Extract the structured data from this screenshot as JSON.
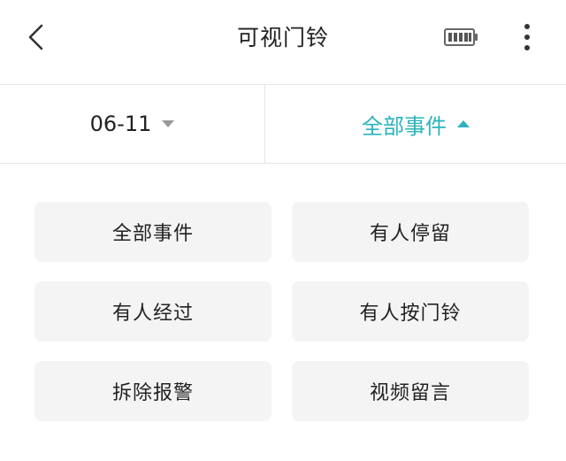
{
  "header": {
    "title": "可视门铃",
    "back_icon": "chevron-left-icon",
    "battery_icon": "battery-full-icon",
    "more_icon": "more-vertical-icon"
  },
  "filters": {
    "date": {
      "label": "06-11",
      "icon": "caret-down-icon"
    },
    "events": {
      "label": "全部事件",
      "icon": "caret-up-icon",
      "active": true
    }
  },
  "colors": {
    "accent": "#2bb3bd",
    "option_bg": "#f4f4f4",
    "divider": "#e6e6e6"
  },
  "options": [
    {
      "id": "all-events",
      "label": "全部事件"
    },
    {
      "id": "person-lingering",
      "label": "有人停留"
    },
    {
      "id": "person-passing",
      "label": "有人经过"
    },
    {
      "id": "doorbell-pressed",
      "label": "有人按门铃"
    },
    {
      "id": "tamper-alarm",
      "label": "拆除报警"
    },
    {
      "id": "video-message",
      "label": "视频留言"
    }
  ]
}
